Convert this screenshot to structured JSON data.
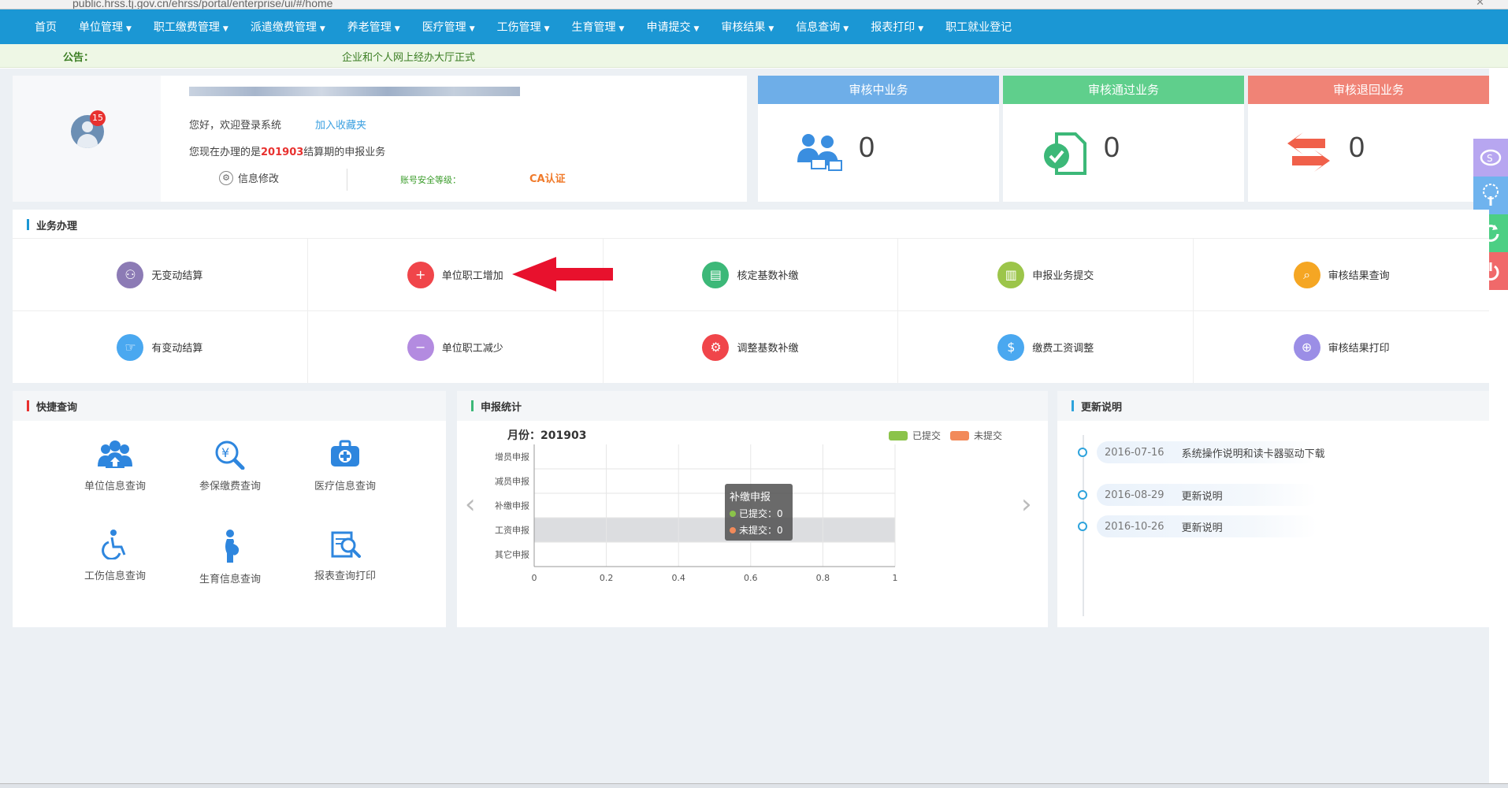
{
  "browser": {
    "url": "public.hrss.tj.gov.cn/ehrss/portal/enterprise/ui/#/home"
  },
  "nav": {
    "items": [
      {
        "label": "首页",
        "has_caret": false
      },
      {
        "label": "单位管理",
        "has_caret": true
      },
      {
        "label": "职工缴费管理",
        "has_caret": true
      },
      {
        "label": "派遣缴费管理",
        "has_caret": true
      },
      {
        "label": "养老管理",
        "has_caret": true
      },
      {
        "label": "医疗管理",
        "has_caret": true
      },
      {
        "label": "工伤管理",
        "has_caret": true
      },
      {
        "label": "生育管理",
        "has_caret": true
      },
      {
        "label": "申请提交",
        "has_caret": true
      },
      {
        "label": "审核结果",
        "has_caret": true
      },
      {
        "label": "信息查询",
        "has_caret": true
      },
      {
        "label": "报表打印",
        "has_caret": true
      },
      {
        "label": "职工就业登记",
        "has_caret": false
      }
    ],
    "caret": "▼",
    "color": "#1b97d4"
  },
  "notice": {
    "label": "公告：",
    "text": "企业和个人网上经办大厅正式"
  },
  "user": {
    "badge": "15",
    "welcome": "您好，欢迎登录系统",
    "favorite": "加入收藏夹",
    "period_prefix": "您现在办理的是",
    "period": "201903",
    "period_suffix": "结算期的申报业务",
    "info_edit": "信息修改",
    "security_label": "账号安全等级：",
    "ca_link": "CA认证"
  },
  "status": [
    {
      "title": "审核中业务",
      "count": "0",
      "color": "#6eaee8",
      "icon": "people-icon"
    },
    {
      "title": "审核通过业务",
      "count": "0",
      "color": "#5fcf8c",
      "icon": "approved-doc-icon"
    },
    {
      "title": "审核退回业务",
      "count": "0",
      "color": "#f08376",
      "icon": "return-arrows-icon"
    }
  ],
  "business": {
    "title": "业务办理",
    "items": [
      {
        "label": "无变动结算",
        "color": "#8c7bb5",
        "glyph": "⚇"
      },
      {
        "label": "单位职工增加",
        "color": "#f0454a",
        "glyph": "+"
      },
      {
        "label": "核定基数补缴",
        "color": "#3cb878",
        "glyph": "▤"
      },
      {
        "label": "申报业务提交",
        "color": "#9cc54a",
        "glyph": "▥"
      },
      {
        "label": "审核结果查询",
        "color": "#f5a623",
        "glyph": "⌕"
      },
      {
        "label": "有变动结算",
        "color": "#4aa8f0",
        "glyph": "☞"
      },
      {
        "label": "单位职工减少",
        "color": "#b38be0",
        "glyph": "−"
      },
      {
        "label": "调整基数补缴",
        "color": "#f0454a",
        "glyph": "⚙"
      },
      {
        "label": "缴费工资调整",
        "color": "#4aa8f0",
        "glyph": "$"
      },
      {
        "label": "审核结果打印",
        "color": "#9b8ee6",
        "glyph": "⊕"
      }
    ]
  },
  "quick": {
    "title": "快捷查询",
    "items": [
      {
        "label": "单位信息查询",
        "icon": "org-icon"
      },
      {
        "label": "参保缴费查询",
        "icon": "yen-search-icon"
      },
      {
        "label": "医疗信息查询",
        "icon": "medkit-icon"
      },
      {
        "label": "工伤信息查询",
        "icon": "wheelchair-icon"
      },
      {
        "label": "生育信息查询",
        "icon": "pregnant-icon"
      },
      {
        "label": "报表查询打印",
        "icon": "report-search-icon"
      }
    ]
  },
  "stats": {
    "title": "申报统计",
    "month_label": "月份：201903",
    "legend": [
      {
        "label": "已提交",
        "color": "#8bc34a"
      },
      {
        "label": "未提交",
        "color": "#f28a5a"
      }
    ],
    "tooltip": {
      "title": "补缴申报",
      "submitted": "已提交：0",
      "unsubmitted": "未提交：0"
    }
  },
  "chart_data": {
    "type": "bar",
    "orientation": "horizontal",
    "categories": [
      "增员申报",
      "减员申报",
      "补缴申报",
      "工资申报",
      "其它申报"
    ],
    "series": [
      {
        "name": "已提交",
        "values": [
          0,
          0,
          0,
          0,
          0
        ]
      },
      {
        "name": "未提交",
        "values": [
          0,
          0,
          0,
          0,
          0
        ]
      }
    ],
    "xlim": [
      0,
      1
    ],
    "x_ticks": [
      "0",
      "0.2",
      "0.4",
      "0.6",
      "0.8",
      "1"
    ],
    "highlighted_category": "工资申报",
    "grid": true
  },
  "updates": {
    "title": "更新说明",
    "items": [
      {
        "date": "2016-07-16",
        "text": "系统操作说明和读卡器驱动下载"
      },
      {
        "date": "2016-08-29",
        "text": "更新说明"
      },
      {
        "date": "2016-10-26",
        "text": "更新说明"
      }
    ]
  },
  "float_bar": [
    {
      "icon": "service-icon",
      "color": "#b7a6f0"
    },
    {
      "icon": "tree-icon",
      "color": "#6fb3ee"
    },
    {
      "icon": "refresh-icon",
      "color": "#4ccf84"
    },
    {
      "icon": "power-icon",
      "color": "#f0696a"
    }
  ]
}
